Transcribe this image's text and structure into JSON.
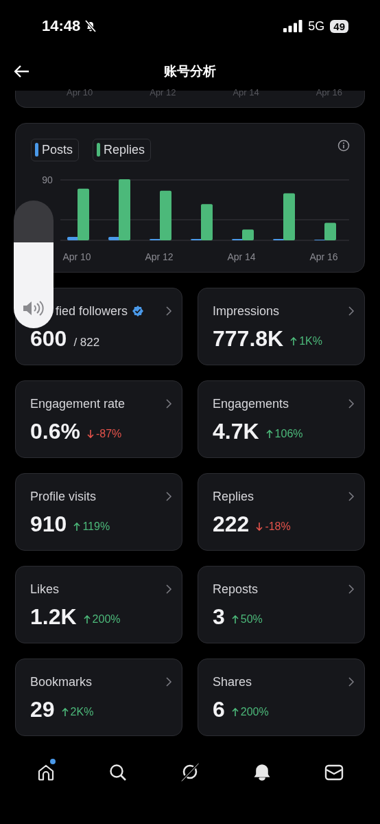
{
  "status_bar": {
    "time": "14:48",
    "network": "5G",
    "battery": "49"
  },
  "header": {
    "title": "账号分析"
  },
  "previous_chart_axis": [
    "Apr 10",
    "Apr 12",
    "Apr 14",
    "Apr 16"
  ],
  "chart_card": {
    "legend": [
      {
        "label": "Posts",
        "color": "#4a99e9"
      },
      {
        "label": "Replies",
        "color": "#4cb97a"
      }
    ],
    "y_label": "90",
    "x_labels": [
      "Apr 10",
      "Apr 12",
      "Apr 14",
      "Apr 16"
    ]
  },
  "metrics": [
    {
      "label": "fied followers",
      "cut_by_overlay": true,
      "verified": true,
      "value": "600",
      "total": "/ 822"
    },
    {
      "label": "Impressions",
      "value": "777.8K",
      "negative": false,
      "change": "1K%"
    },
    {
      "label": "Engagement rate",
      "value": "0.6%",
      "negative": true,
      "change": "-87%"
    },
    {
      "label": "Engagements",
      "value": "4.7K",
      "negative": false,
      "change": "106%"
    },
    {
      "label": "Profile visits",
      "value": "910",
      "negative": false,
      "change": "119%"
    },
    {
      "label": "Replies",
      "value": "222",
      "negative": true,
      "change": "-18%"
    },
    {
      "label": "Likes",
      "value": "1.2K",
      "negative": false,
      "change": "200%"
    },
    {
      "label": "Reposts",
      "value": "3",
      "negative": false,
      "change": "50%"
    },
    {
      "label": "Bookmarks",
      "value": "29",
      "negative": false,
      "change": "2K%"
    },
    {
      "label": "Shares",
      "value": "6",
      "negative": false,
      "change": "200%"
    }
  ],
  "volume_hud": {
    "level": 0.67
  },
  "tab_bar": [
    {
      "kind": "home",
      "selected": false,
      "badge": true
    },
    {
      "kind": "search",
      "selected": false,
      "badge": false
    },
    {
      "kind": "grok",
      "selected": false,
      "badge": false
    },
    {
      "kind": "notifications",
      "selected": true,
      "badge": false
    },
    {
      "kind": "messages",
      "selected": false,
      "badge": false
    }
  ]
}
